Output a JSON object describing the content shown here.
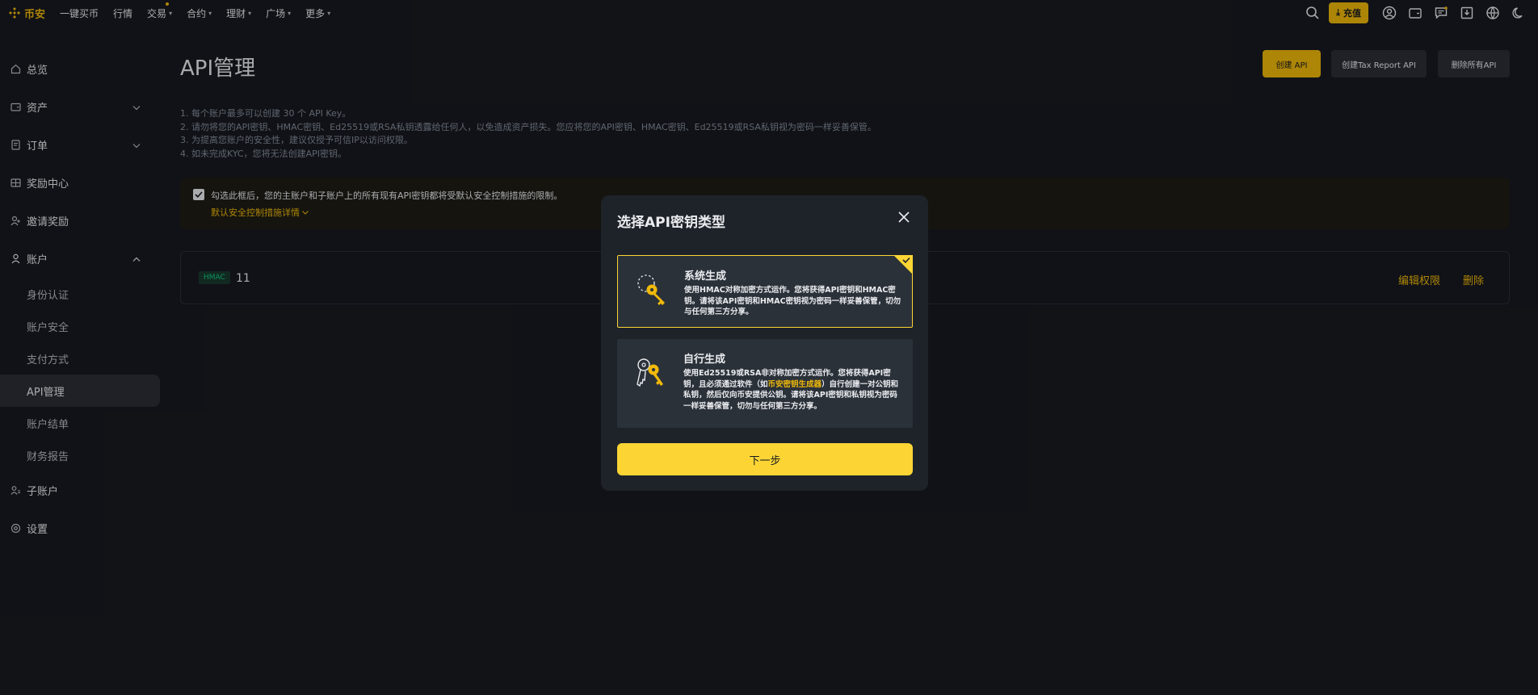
{
  "topnav": {
    "logo_text": "币安",
    "items": [
      {
        "label": "一键买币",
        "chevron": false
      },
      {
        "label": "行情",
        "chevron": false
      },
      {
        "label": "交易",
        "chevron": true,
        "dot": true
      },
      {
        "label": "合约",
        "chevron": true
      },
      {
        "label": "理财",
        "chevron": true
      },
      {
        "label": "广场",
        "chevron": true
      },
      {
        "label": "更多",
        "chevron": true
      }
    ],
    "deposit_label": "充值",
    "accent_color": "#f0b90b"
  },
  "sidebar": {
    "items": [
      {
        "label": "总览",
        "icon": "home-icon"
      },
      {
        "label": "资产",
        "icon": "wallet-icon",
        "chevron": "down"
      },
      {
        "label": "订单",
        "icon": "order-icon",
        "chevron": "down"
      },
      {
        "label": "奖励中心",
        "icon": "reward-icon"
      },
      {
        "label": "邀请奖励",
        "icon": "invite-icon"
      },
      {
        "label": "账户",
        "icon": "user-icon",
        "chevron": "up"
      }
    ],
    "account_sub": [
      {
        "label": "身份认证"
      },
      {
        "label": "账户安全"
      },
      {
        "label": "支付方式"
      },
      {
        "label": "API管理",
        "active": true
      },
      {
        "label": "账户结单"
      },
      {
        "label": "财务报告"
      }
    ],
    "bottom_items": [
      {
        "label": "子账户",
        "icon": "sub-account-icon"
      },
      {
        "label": "设置",
        "icon": "settings-icon"
      }
    ]
  },
  "main": {
    "title": "API管理",
    "buttons": {
      "create": "创建 API",
      "tax": "创建Tax Report API",
      "delete_all": "删除所有API"
    },
    "notes": [
      "1. 每个账户最多可以创建 30 个 API Key。",
      "2. 请勿将您的API密钥、HMAC密钥、Ed25519或RSA私钥透露给任何人，以免造成资产损失。您应将您的API密钥、HMAC密钥、Ed25519或RSA私钥视为密码一样妥善保管。",
      "3. 为提高您账户的安全性，建议仅授予可信IP以访问权限。",
      "4. 如未完成KYC，您将无法创建API密钥。"
    ],
    "warning": {
      "text": "勾选此框后，您的主账户和子账户上的所有现有API密钥都将受默认安全控制措施的限制。",
      "link": "默认安全控制措施详情"
    },
    "api_row": {
      "tag": "HMAC",
      "name": "11",
      "edit": "编辑权限",
      "delete": "删除"
    }
  },
  "modal": {
    "title": "选择API密钥类型",
    "option1": {
      "title": "系统生成",
      "desc": "使用HMAC对称加密方式运作。您将获得API密钥和HMAC密钥。请将该API密钥和HMAC密钥视为密码一样妥善保管，切勿与任何第三方分享。"
    },
    "option2": {
      "title": "自行生成",
      "desc_a": "使用Ed25519或RSA非对称加密方式运作。您将获得API密钥，且必须通过软件（如",
      "desc_link": "币安密钥生成器",
      "desc_b": "）自行创建一对公钥和私钥，然后仅向币安提供公钥。请将该API密钥和私钥视为密码一样妥善保管，切勿与任何第三方分享。"
    },
    "next_label": "下一步"
  }
}
